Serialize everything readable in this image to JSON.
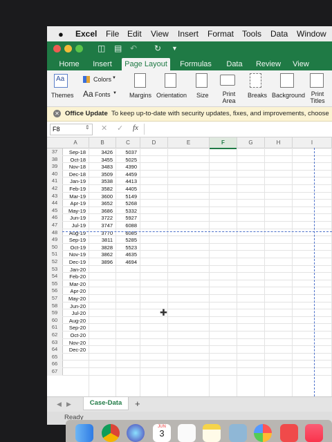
{
  "menubar": {
    "apple": "",
    "items": [
      "Excel",
      "File",
      "Edit",
      "View",
      "Insert",
      "Format",
      "Tools",
      "Data",
      "Window"
    ]
  },
  "ribbon": {
    "tabs": [
      "Home",
      "Insert",
      "Page Layout",
      "Formulas",
      "Data",
      "Review",
      "View"
    ],
    "active_tab": "Page Layout",
    "colors_label": "Colors",
    "themes_label": "Themes",
    "fonts_label": "Fonts",
    "margins_label": "Margins",
    "orientation_label": "Orientation",
    "size_label": "Size",
    "print_area_label": "Print Area",
    "breaks_label": "Breaks",
    "background_label": "Background",
    "print_titles_label": "Print Titles"
  },
  "update_bar": {
    "title": "Office Update",
    "message": "To keep up-to-date with security updates, fixes, and improvements, choose"
  },
  "formula_bar": {
    "name_box": "F8",
    "fx": "fx",
    "value": ""
  },
  "grid": {
    "columns": [
      "A",
      "B",
      "C",
      "D",
      "E",
      "F",
      "G",
      "H",
      "I"
    ],
    "selected_column": "F",
    "rows": [
      {
        "n": "37",
        "a": "Sep-18",
        "b": "3426",
        "c": "5037"
      },
      {
        "n": "38",
        "a": "Oct-18",
        "b": "3455",
        "c": "5025"
      },
      {
        "n": "39",
        "a": "Nov-18",
        "b": "3483",
        "c": "4390"
      },
      {
        "n": "40",
        "a": "Dec-18",
        "b": "3509",
        "c": "4459"
      },
      {
        "n": "41",
        "a": "Jan-19",
        "b": "3538",
        "c": "4413"
      },
      {
        "n": "42",
        "a": "Feb-19",
        "b": "3582",
        "c": "4405"
      },
      {
        "n": "43",
        "a": "Mar-19",
        "b": "3600",
        "c": "5149"
      },
      {
        "n": "44",
        "a": "Apr-19",
        "b": "3652",
        "c": "5268"
      },
      {
        "n": "45",
        "a": "May-19",
        "b": "3686",
        "c": "5332"
      },
      {
        "n": "46",
        "a": "Jun-19",
        "b": "3722",
        "c": "5927"
      },
      {
        "n": "47",
        "a": "Jul-19",
        "b": "3747",
        "c": "6088"
      },
      {
        "n": "48",
        "a": "Aug-19",
        "b": "3770",
        "c": "6085"
      },
      {
        "n": "49",
        "a": "Sep-19",
        "b": "3811",
        "c": "5285"
      },
      {
        "n": "50",
        "a": "Oct-19",
        "b": "3828",
        "c": "5523"
      },
      {
        "n": "51",
        "a": "Nov-19",
        "b": "3862",
        "c": "4635"
      },
      {
        "n": "52",
        "a": "Dec-19",
        "b": "3896",
        "c": "4694"
      },
      {
        "n": "53",
        "a": "Jan-20",
        "b": "",
        "c": ""
      },
      {
        "n": "54",
        "a": "Feb-20",
        "b": "",
        "c": ""
      },
      {
        "n": "55",
        "a": "Mar-20",
        "b": "",
        "c": ""
      },
      {
        "n": "56",
        "a": "Apr-20",
        "b": "",
        "c": ""
      },
      {
        "n": "57",
        "a": "May-20",
        "b": "",
        "c": ""
      },
      {
        "n": "58",
        "a": "Jun-20",
        "b": "",
        "c": ""
      },
      {
        "n": "59",
        "a": "Jul-20",
        "b": "",
        "c": ""
      },
      {
        "n": "60",
        "a": "Aug-20",
        "b": "",
        "c": ""
      },
      {
        "n": "61",
        "a": "Sep-20",
        "b": "",
        "c": ""
      },
      {
        "n": "62",
        "a": "Oct-20",
        "b": "",
        "c": ""
      },
      {
        "n": "63",
        "a": "Nov-20",
        "b": "",
        "c": ""
      },
      {
        "n": "64",
        "a": "Dec-20",
        "b": "",
        "c": ""
      },
      {
        "n": "65",
        "a": "",
        "b": "",
        "c": ""
      },
      {
        "n": "66",
        "a": "",
        "b": "",
        "c": ""
      },
      {
        "n": "67",
        "a": "",
        "b": "",
        "c": ""
      }
    ]
  },
  "sheets": {
    "tabs": [
      "Case-Data"
    ],
    "add_label": "+"
  },
  "status": {
    "text": "Ready"
  },
  "dock": {
    "calendar_month": "JUN",
    "calendar_day": "3",
    "icons": [
      "finder-icon",
      "chrome-icon",
      "siri-icon",
      "calendar-icon",
      "reminders-icon",
      "notes-icon",
      "preview-icon",
      "photos-icon",
      "news-icon",
      "music-icon"
    ]
  },
  "colors": {
    "excel_green": "#1f7a45",
    "update_bar": "#fbf3d3",
    "page_break": "#4a6fc9"
  }
}
